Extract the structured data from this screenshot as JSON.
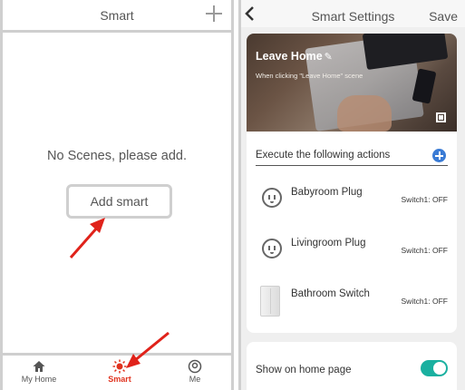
{
  "left_screen": {
    "title": "Smart",
    "empty_message": "No Scenes, please add.",
    "add_button_label": "Add  smart",
    "tabs": [
      {
        "label": "My Home",
        "icon": "home-icon"
      },
      {
        "label": "Smart",
        "icon": "sun-icon",
        "active": true
      },
      {
        "label": "Me",
        "icon": "user-circle-icon"
      }
    ],
    "active_color": "#e0321e"
  },
  "right_screen": {
    "title": "Smart Settings",
    "save_label": "Save",
    "hero": {
      "title": "Leave Home",
      "pencil": "✎",
      "subtitle": "When clicking \"Leave Home\" scene"
    },
    "actions_label": "Execute the following actions",
    "devices": [
      {
        "name": "Babyroom Plug",
        "state": "Switch1: OFF",
        "icon": "plug-icon"
      },
      {
        "name": "Livingroom Plug",
        "state": "Switch1: OFF",
        "icon": "plug-icon"
      },
      {
        "name": "Bathroom Switch",
        "state": "Switch1: OFF",
        "icon": "wall-switch-icon"
      }
    ],
    "show_on_home_label": "Show on home page",
    "show_on_home_enabled": true,
    "accent_color": "#3a7bd5",
    "toggle_color": "#1ab0a0"
  }
}
